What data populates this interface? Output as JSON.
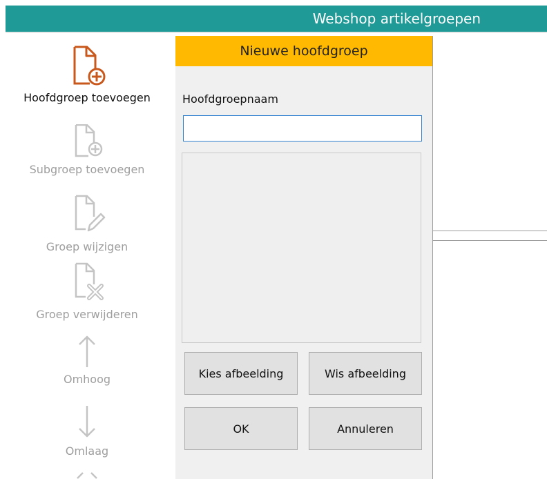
{
  "window": {
    "title": "Webshop artikelgroepen"
  },
  "toolbar": {
    "items": [
      {
        "label": "Hoofdgroep toevoegen",
        "icon": "document-add-icon",
        "state": "active"
      },
      {
        "label": "Subgroep toevoegen",
        "icon": "document-add-icon",
        "state": "disabled"
      },
      {
        "label": "Groep wijzigen",
        "icon": "document-edit-icon",
        "state": "disabled"
      },
      {
        "label": "Groep verwijderen",
        "icon": "document-delete-icon",
        "state": "disabled"
      },
      {
        "label": "Omhoog",
        "icon": "arrow-up-icon",
        "state": "disabled"
      },
      {
        "label": "Omlaag",
        "icon": "arrow-down-icon",
        "state": "disabled"
      }
    ]
  },
  "dialog": {
    "title": "Nieuwe hoofdgroep",
    "name_label": "Hoofdgroepnaam",
    "name_value": "",
    "choose_image": "Kies afbeelding",
    "clear_image": "Wis afbeelding",
    "ok": "OK",
    "cancel": "Annuleren"
  },
  "colors": {
    "titlebar": "#1f9a96",
    "dialog_header": "#ffb900",
    "active_icon": "#c9581c",
    "disabled": "#bdbdbd"
  }
}
